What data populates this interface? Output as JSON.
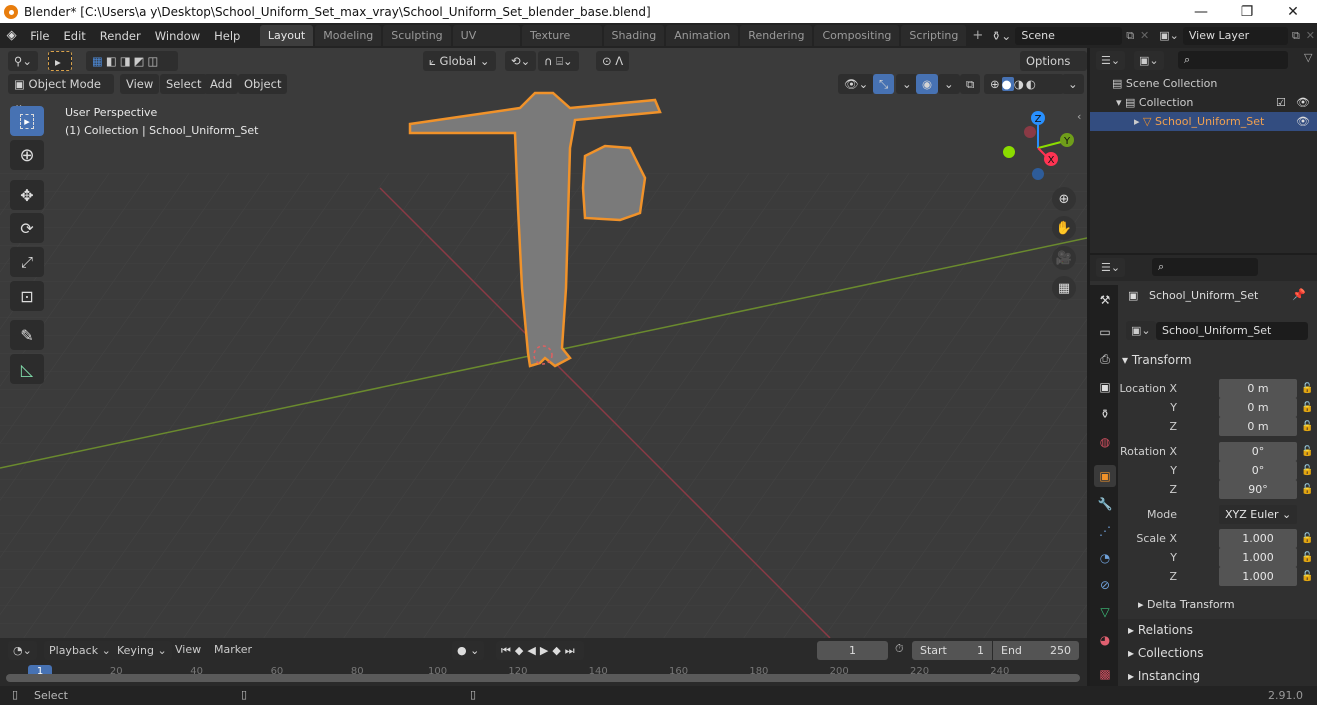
{
  "window": {
    "title": "Blender* [C:\\Users\\a y\\Desktop\\School_Uniform_Set_max_vray\\School_Uniform_Set_blender_base.blend]",
    "minimize": "—",
    "maximize": "❐",
    "close": "✕"
  },
  "menu": [
    "File",
    "Edit",
    "Render",
    "Window",
    "Help"
  ],
  "workspaces": [
    "Layout",
    "Modeling",
    "Sculpting",
    "UV Editing",
    "Texture Paint",
    "Shading",
    "Animation",
    "Rendering",
    "Compositing",
    "Scripting"
  ],
  "active_workspace": "Layout",
  "add_workspace": "+",
  "scene": {
    "label": "Scene"
  },
  "view_layer": {
    "label": "View Layer"
  },
  "viewport": {
    "transform_orientation": "Global",
    "options": "Options",
    "mode": "Object Mode",
    "header_menus": [
      "View",
      "Select",
      "Add",
      "Object"
    ],
    "overlay_text_1": "User Perspective",
    "overlay_text_2": "(1) Collection | School_Uniform_Set",
    "gizmo_axes": {
      "x": "X",
      "y": "Y",
      "z": "Z"
    },
    "colors": {
      "x": "#ff3352",
      "y": "#8bdc00",
      "z": "#2890ff",
      "selection": "#f0922a",
      "grid": "#4a4a4a",
      "bg": "#3b3b3b"
    }
  },
  "outliner": {
    "search_placeholder": "",
    "items": [
      {
        "label": "Scene Collection",
        "level": 0
      },
      {
        "label": "Collection",
        "level": 1
      },
      {
        "label": "School_Uniform_Set",
        "level": 2,
        "selected": true
      }
    ]
  },
  "properties": {
    "object_name": "School_Uniform_Set",
    "object_field": "School_Uniform_Set",
    "transform_title": "Transform",
    "location": {
      "label": "Location X",
      "x": "0 m",
      "y": "0 m",
      "z": "0 m"
    },
    "rotation": {
      "label": "Rotation X",
      "x": "0°",
      "y": "0°",
      "z": "90°"
    },
    "mode_label": "Mode",
    "mode_value": "XYZ Euler",
    "scale": {
      "label": "Scale X",
      "x": "1.000",
      "y": "1.000",
      "z": "1.000"
    },
    "axis_y": "Y",
    "axis_z": "Z",
    "delta_transform": "Delta Transform",
    "panels": [
      "Relations",
      "Collections",
      "Instancing"
    ]
  },
  "timeline": {
    "menus": [
      "Playback",
      "Keying",
      "View",
      "Marker"
    ],
    "current_frame": "1",
    "start_label": "Start",
    "start": "1",
    "end_label": "End",
    "end": "250",
    "ticks": [
      "20",
      "40",
      "60",
      "80",
      "100",
      "120",
      "140",
      "160",
      "180",
      "200",
      "220",
      "240"
    ],
    "playhead": "1"
  },
  "status": {
    "select": "Select",
    "version": "2.91.0"
  }
}
